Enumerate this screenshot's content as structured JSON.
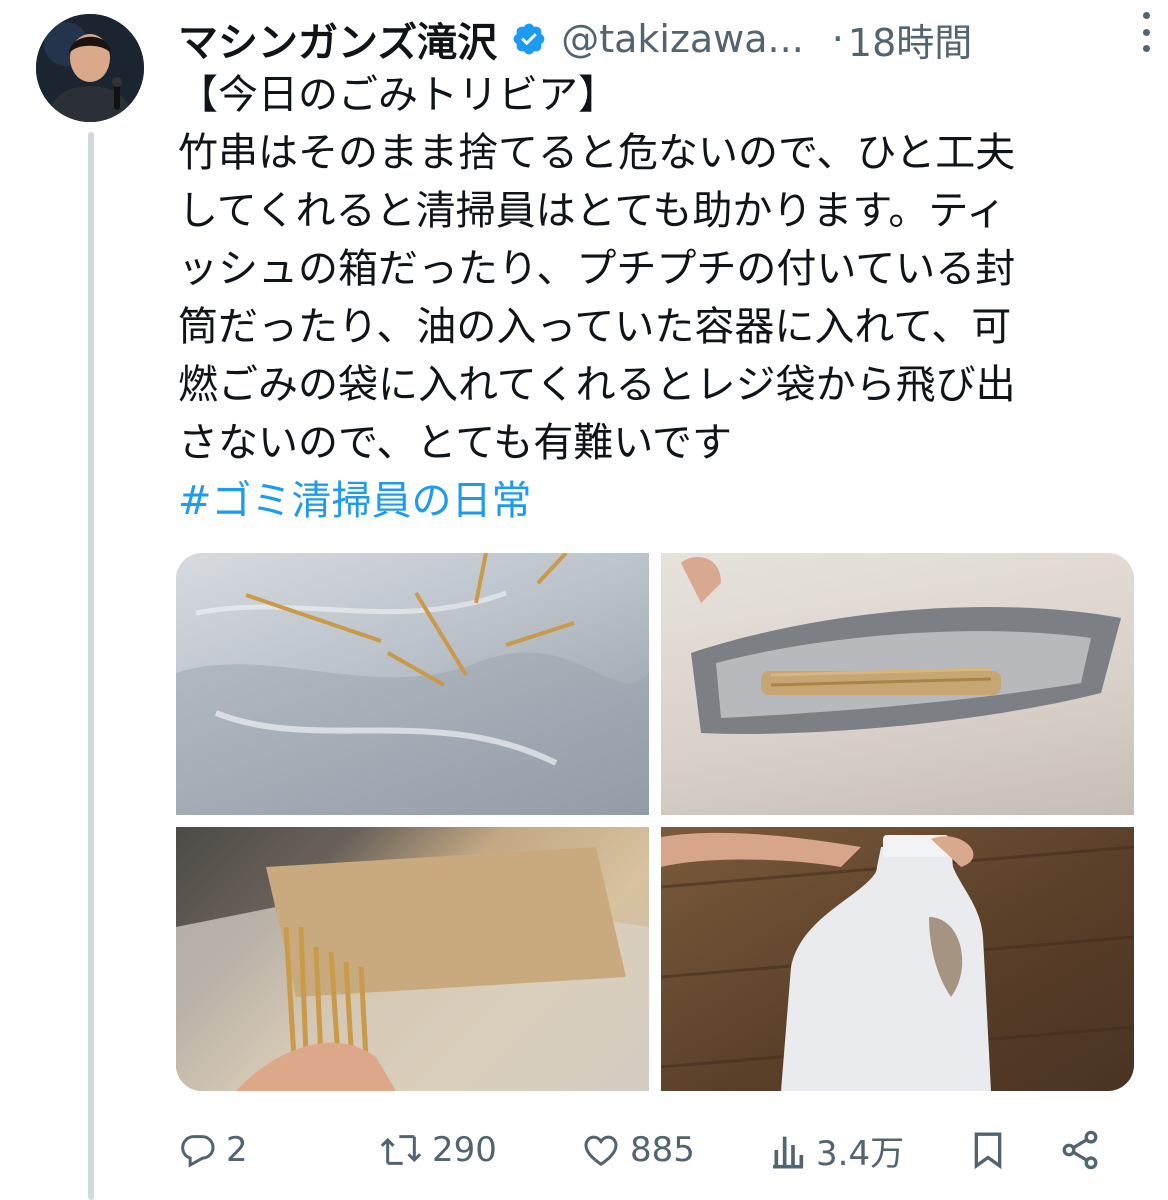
{
  "tweet": {
    "display_name": "マシンガンズ滝沢",
    "handle": "@takizawa...",
    "separator": "·",
    "time": "18時間",
    "lines": [
      "【今日のごみトリビア】",
      "竹串はそのまま捨てると危ないので、ひと工夫",
      "してくれると清掃員はとても助かります。ティ",
      "ッシュの箱だったり、プチプチの付いている封",
      "筒だったり、油の入っていた容器に入れて、可",
      "燃ごみの袋に入れてくれるとレジ袋から飛び出",
      "さないので、とても有難いです"
    ],
    "hashtag": "#ゴミ清掃員の日常"
  },
  "actions": {
    "replies": "2",
    "retweets": "290",
    "likes": "885",
    "views": "3.4万"
  },
  "colors": {
    "accent": "#1d9bf0",
    "muted": "#536471",
    "text": "#0f1419",
    "thread_line": "#cfd9de"
  },
  "icons": {
    "more": "more-vertical-icon",
    "verified": "verified-badge-icon",
    "reply": "reply-icon",
    "retweet": "retweet-icon",
    "like": "heart-icon",
    "views": "views-icon",
    "bookmark": "bookmark-icon",
    "share": "share-icon"
  }
}
